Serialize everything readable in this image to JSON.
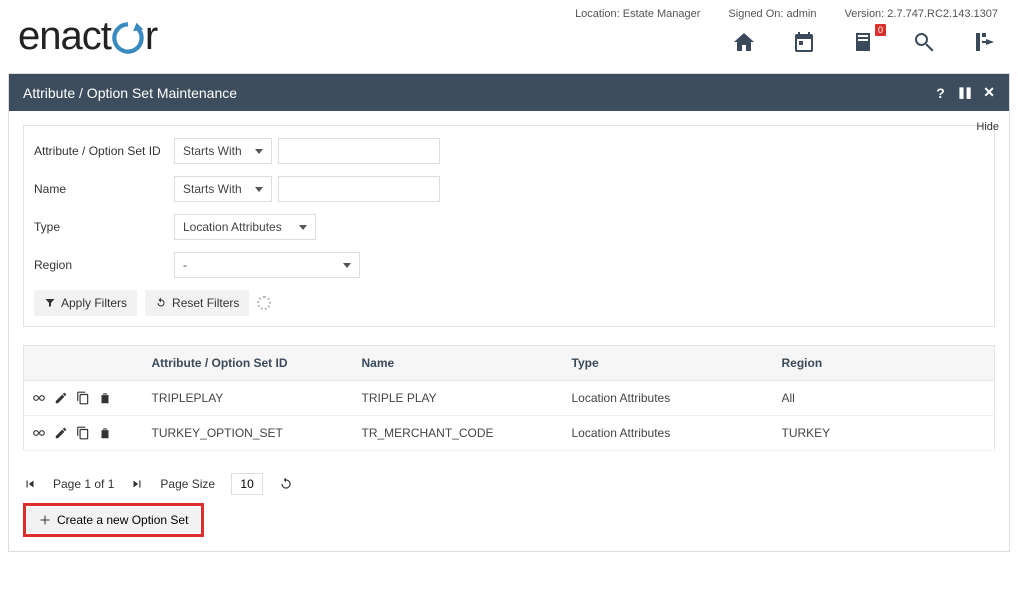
{
  "header": {
    "brand": "enactor",
    "location_label": "Location: Estate Manager",
    "signed_on_label": "Signed On: admin",
    "version_label": "Version: 2.7.747.RC2.143.1307",
    "notif_badge": "0"
  },
  "panel": {
    "title": "Attribute / Option Set Maintenance",
    "help": "?",
    "pause": "❚❚",
    "close": "✕",
    "hide": "Hide"
  },
  "filters": {
    "id_label": "Attribute / Option Set ID",
    "id_op": "Starts With",
    "id_value": "",
    "name_label": "Name",
    "name_op": "Starts With",
    "name_value": "",
    "type_label": "Type",
    "type_value": "Location Attributes",
    "region_label": "Region",
    "region_value": "-",
    "apply": "Apply Filters",
    "reset": "Reset Filters"
  },
  "table": {
    "cols": {
      "c0": "",
      "c1": "Attribute / Option Set ID",
      "c2": "Name",
      "c3": "Type",
      "c4": "Region"
    },
    "rows": [
      {
        "id": "TRIPLEPLAY",
        "name": "TRIPLE PLAY",
        "type": "Location Attributes",
        "region": "All"
      },
      {
        "id": "TURKEY_OPTION_SET",
        "name": "TR_MERCHANT_CODE",
        "type": "Location Attributes",
        "region": "TURKEY"
      }
    ]
  },
  "pager": {
    "page_text": "Page 1 of 1",
    "size_label": "Page Size",
    "size_value": "10"
  },
  "create": {
    "label": "Create a new Option Set"
  }
}
